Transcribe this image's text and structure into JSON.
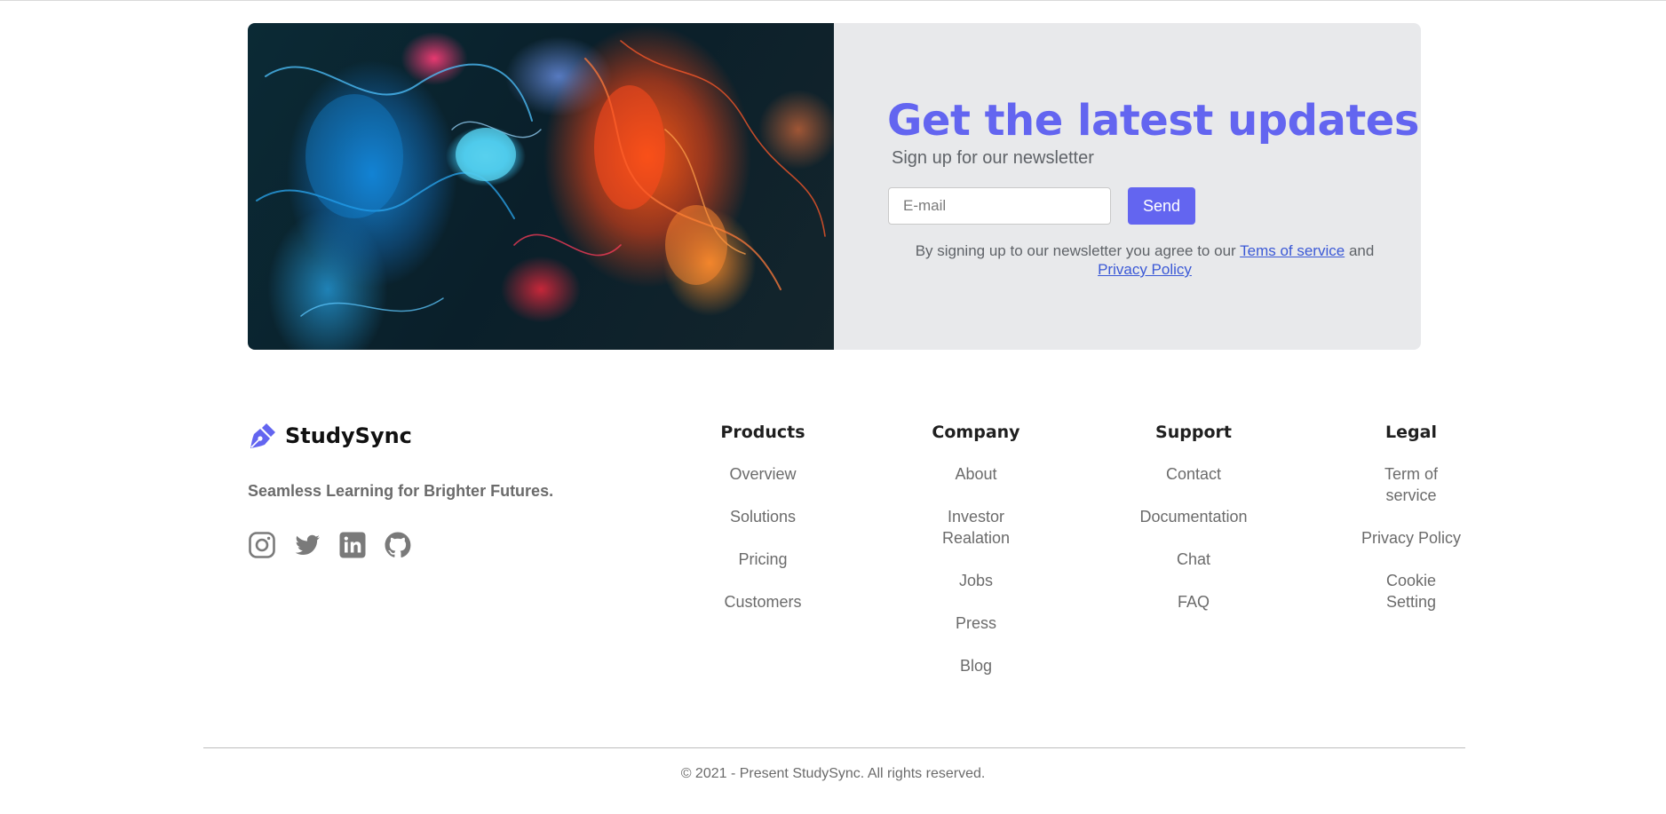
{
  "newsletter": {
    "title": "Get the latest updates",
    "subtitle": "Sign up for our newsletter",
    "email_placeholder": "E-mail",
    "email_value": "",
    "send_label": "Send",
    "terms_prefix": "By signing up to our newsletter you agree to our",
    "terms_link": "Tems of service",
    "terms_and": "and",
    "privacy_link": "Privacy Policy"
  },
  "brand": {
    "name": "StudySync",
    "icon": "pen-nib-icon",
    "tagline": "Seamless Learning for Brighter Futures."
  },
  "socials": [
    {
      "icon": "instagram-icon"
    },
    {
      "icon": "twitter-icon"
    },
    {
      "icon": "linkedin-icon"
    },
    {
      "icon": "github-icon"
    }
  ],
  "columns": {
    "products": {
      "heading": "Products",
      "items": [
        "Overview",
        "Solutions",
        "Pricing",
        "Customers"
      ]
    },
    "company": {
      "heading": "Company",
      "items": [
        "About",
        "Investor Realation",
        "Jobs",
        "Press",
        "Blog"
      ]
    },
    "support": {
      "heading": "Support",
      "items": [
        "Contact",
        "Documentation",
        "Chat",
        "FAQ"
      ]
    },
    "legal": {
      "heading": "Legal",
      "items": [
        "Term of service",
        "Privacy Policy",
        "Cookie Setting"
      ]
    }
  },
  "copyright": "© 2021 - Present StudySync. All rights reserved.",
  "colors": {
    "accent": "#6365f0",
    "link": "#3b59d6",
    "card_bg": "#e8e9eb",
    "muted_text": "#6b6b6b"
  }
}
